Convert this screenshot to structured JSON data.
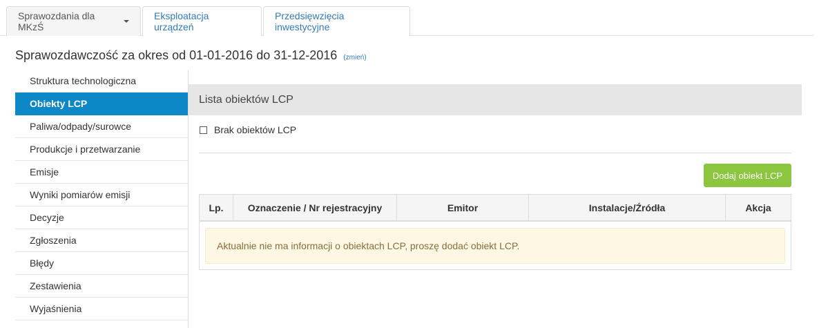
{
  "tabs": [
    {
      "label": "Sprawozdania dla MKzŚ",
      "active": true
    },
    {
      "label": "Eksploatacja urządzeń",
      "active": false
    },
    {
      "label": "Przedsięwzięcia inwestycyjne",
      "active": false
    }
  ],
  "period": {
    "text": "Sprawozdawczość za okres od 01-01-2016 do 31-12-2016",
    "change_label": "(zmień)"
  },
  "sidebar": {
    "items": [
      {
        "label": "Struktura technologiczna"
      },
      {
        "label": "Obiekty LCP",
        "active": true
      },
      {
        "label": "Paliwa/odpady/surowce"
      },
      {
        "label": "Produkcje i przetwarzanie"
      },
      {
        "label": "Emisje"
      },
      {
        "label": "Wyniki pomiarów emisji"
      },
      {
        "label": "Decyzje"
      },
      {
        "label": "Zgłoszenia"
      },
      {
        "label": "Błędy"
      },
      {
        "label": "Zestawienia"
      },
      {
        "label": "Wyjaśnienia"
      }
    ]
  },
  "panel": {
    "title": "Lista obiektów LCP",
    "checkbox_label": "Brak obiektów LCP",
    "checkbox_checked": false,
    "add_button": "Dodaj obiekt LCP"
  },
  "table": {
    "columns": [
      "Lp.",
      "Oznaczenie / Nr rejestracyjny",
      "Emitor",
      "Instalacje/Źródła",
      "Akcja"
    ],
    "empty_message": "Aktualnie nie ma informacji o obiektach LCP, proszę dodać obiekt LCP."
  },
  "colors": {
    "accent": "#0e87c6",
    "success": "#8cc63f",
    "warning_bg": "#fcf8e3",
    "warning_text": "#8a6d3b"
  }
}
